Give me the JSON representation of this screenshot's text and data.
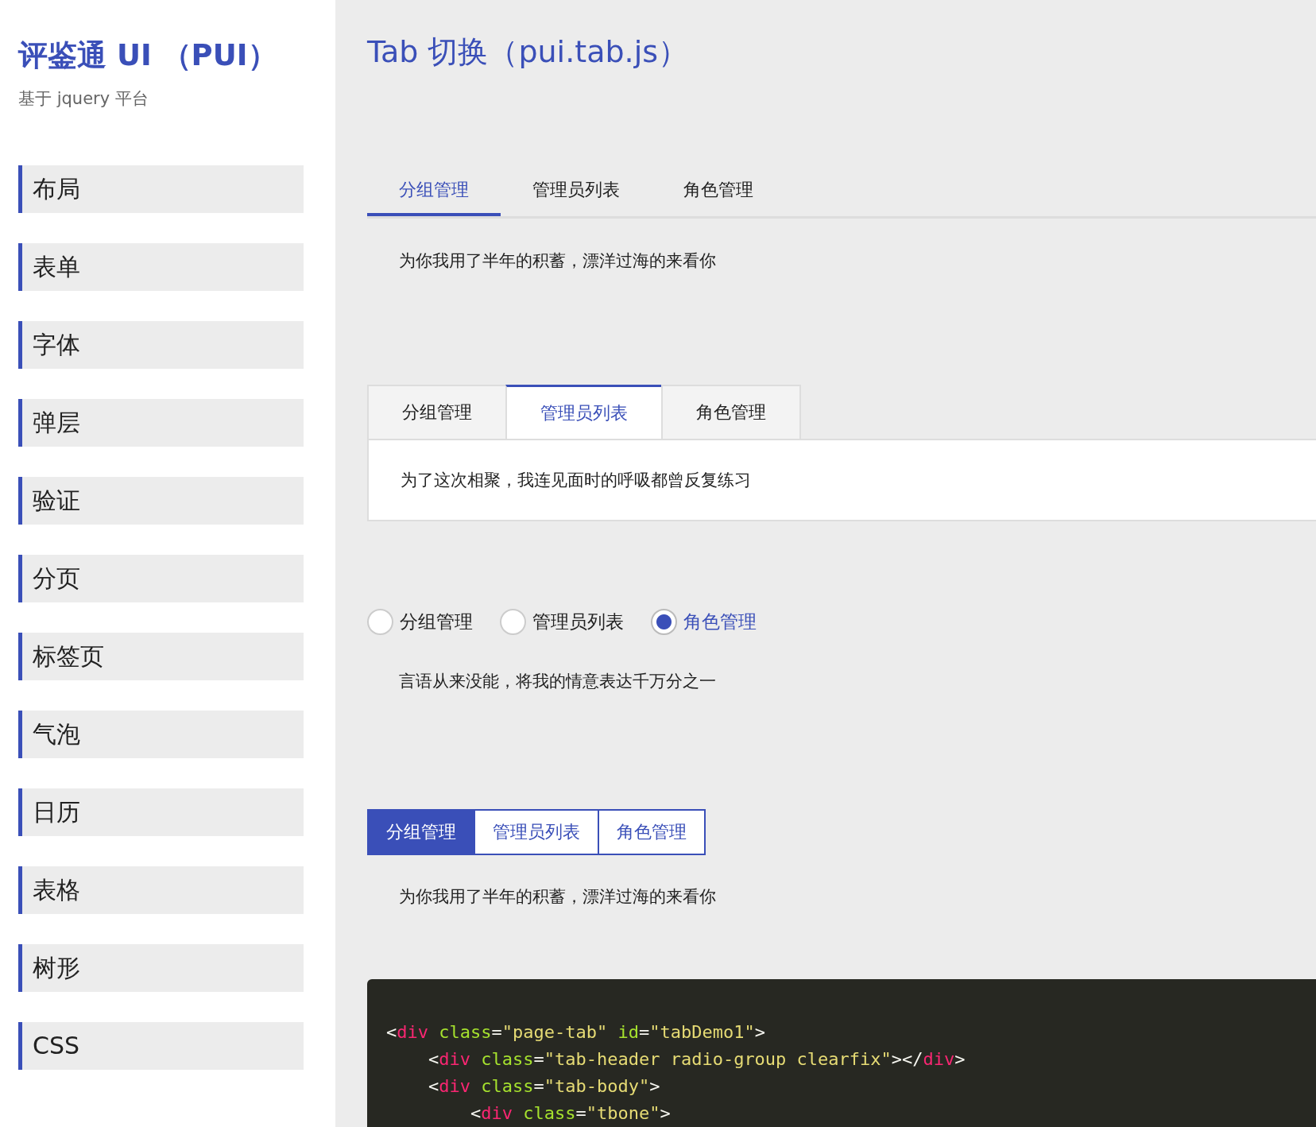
{
  "sidebar": {
    "title": "评鉴通 UI （PUI）",
    "subtitle": "基于 jquery 平台",
    "items": [
      {
        "label": "布局"
      },
      {
        "label": "表单"
      },
      {
        "label": "字体"
      },
      {
        "label": "弹层"
      },
      {
        "label": "验证"
      },
      {
        "label": "分页"
      },
      {
        "label": "标签页"
      },
      {
        "label": "气泡"
      },
      {
        "label": "日历"
      },
      {
        "label": "表格"
      },
      {
        "label": "树形"
      },
      {
        "label": "CSS"
      }
    ]
  },
  "main": {
    "title": "Tab 切换（pui.tab.js）",
    "demos": [
      {
        "kind": "line",
        "tabs": [
          {
            "label": "分组管理",
            "selected": true
          },
          {
            "label": "管理员列表",
            "selected": false
          },
          {
            "label": "角色管理",
            "selected": false
          }
        ],
        "content": "为你我用了半年的积蓄，漂洋过海的来看你"
      },
      {
        "kind": "card",
        "tabs": [
          {
            "label": "分组管理",
            "selected": false
          },
          {
            "label": "管理员列表",
            "selected": true
          },
          {
            "label": "角色管理",
            "selected": false
          }
        ],
        "content": "为了这次相聚，我连见面时的呼吸都曾反复练习"
      },
      {
        "kind": "radio",
        "tabs": [
          {
            "label": "分组管理",
            "selected": false
          },
          {
            "label": "管理员列表",
            "selected": false
          },
          {
            "label": "角色管理",
            "selected": true
          }
        ],
        "content": "言语从来没能，将我的情意表达千万分之一"
      },
      {
        "kind": "button",
        "tabs": [
          {
            "label": "分组管理",
            "selected": true
          },
          {
            "label": "管理员列表",
            "selected": false
          },
          {
            "label": "角色管理",
            "selected": false
          }
        ],
        "content": "为你我用了半年的积蓄，漂洋过海的来看你"
      }
    ],
    "code": [
      "<div class=\"page-tab\" id=\"tabDemo1\">",
      "    <div class=\"tab-header radio-group clearfix\"></div>",
      "    <div class=\"tab-body\">",
      "        <div class=\"tbone\">"
    ]
  }
}
